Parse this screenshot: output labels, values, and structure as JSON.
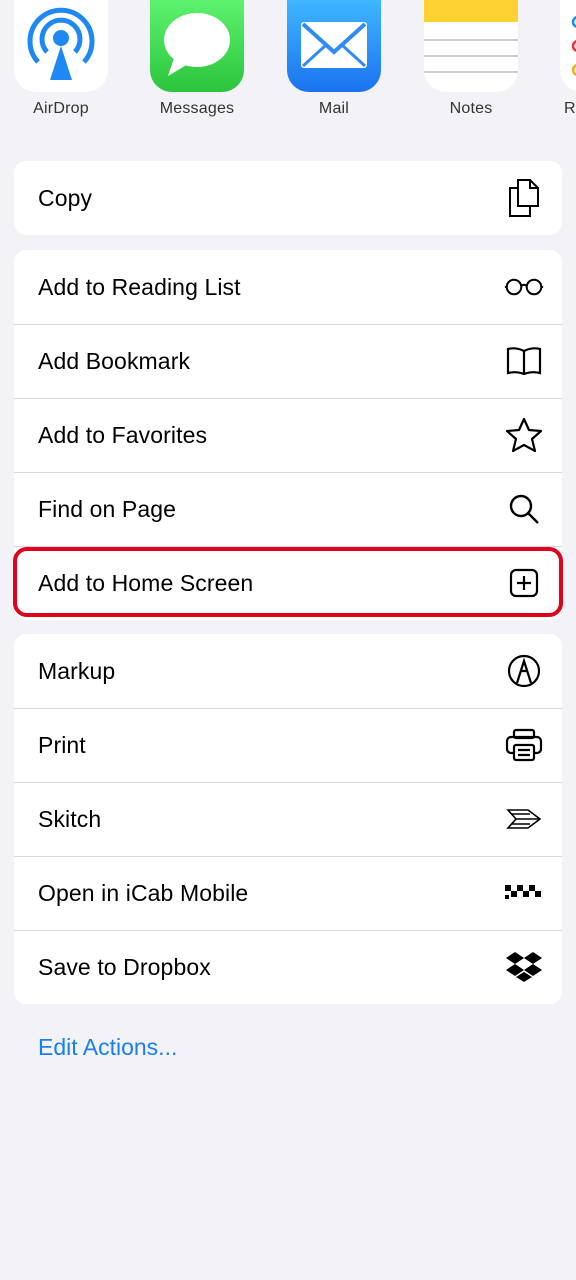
{
  "apps": [
    {
      "name": "AirDrop",
      "icon": "airdrop-icon"
    },
    {
      "name": "Messages",
      "icon": "messages-icon"
    },
    {
      "name": "Mail",
      "icon": "mail-icon"
    },
    {
      "name": "Notes",
      "icon": "notes-icon"
    },
    {
      "name": "R",
      "icon": "reminders-icon"
    }
  ],
  "groups": {
    "copy": [
      {
        "label": "Copy",
        "icon": "copy-icon"
      }
    ],
    "actions": [
      {
        "label": "Add to Reading List",
        "icon": "glasses-icon"
      },
      {
        "label": "Add Bookmark",
        "icon": "book-icon"
      },
      {
        "label": "Add to Favorites",
        "icon": "star-icon"
      },
      {
        "label": "Find on Page",
        "icon": "search-icon"
      },
      {
        "label": "Add to Home Screen",
        "icon": "add-square-icon"
      }
    ],
    "extensions": [
      {
        "label": "Markup",
        "icon": "markup-icon"
      },
      {
        "label": "Print",
        "icon": "printer-icon"
      },
      {
        "label": "Skitch",
        "icon": "skitch-icon"
      },
      {
        "label": "Open in iCab Mobile",
        "icon": "icab-icon"
      },
      {
        "label": "Save to Dropbox",
        "icon": "dropbox-icon"
      }
    ]
  },
  "edit_actions": "Edit Actions...",
  "colors": {
    "accent": "#1a7ff0",
    "highlight": "#e0001b",
    "background": "#f2f2f7"
  }
}
